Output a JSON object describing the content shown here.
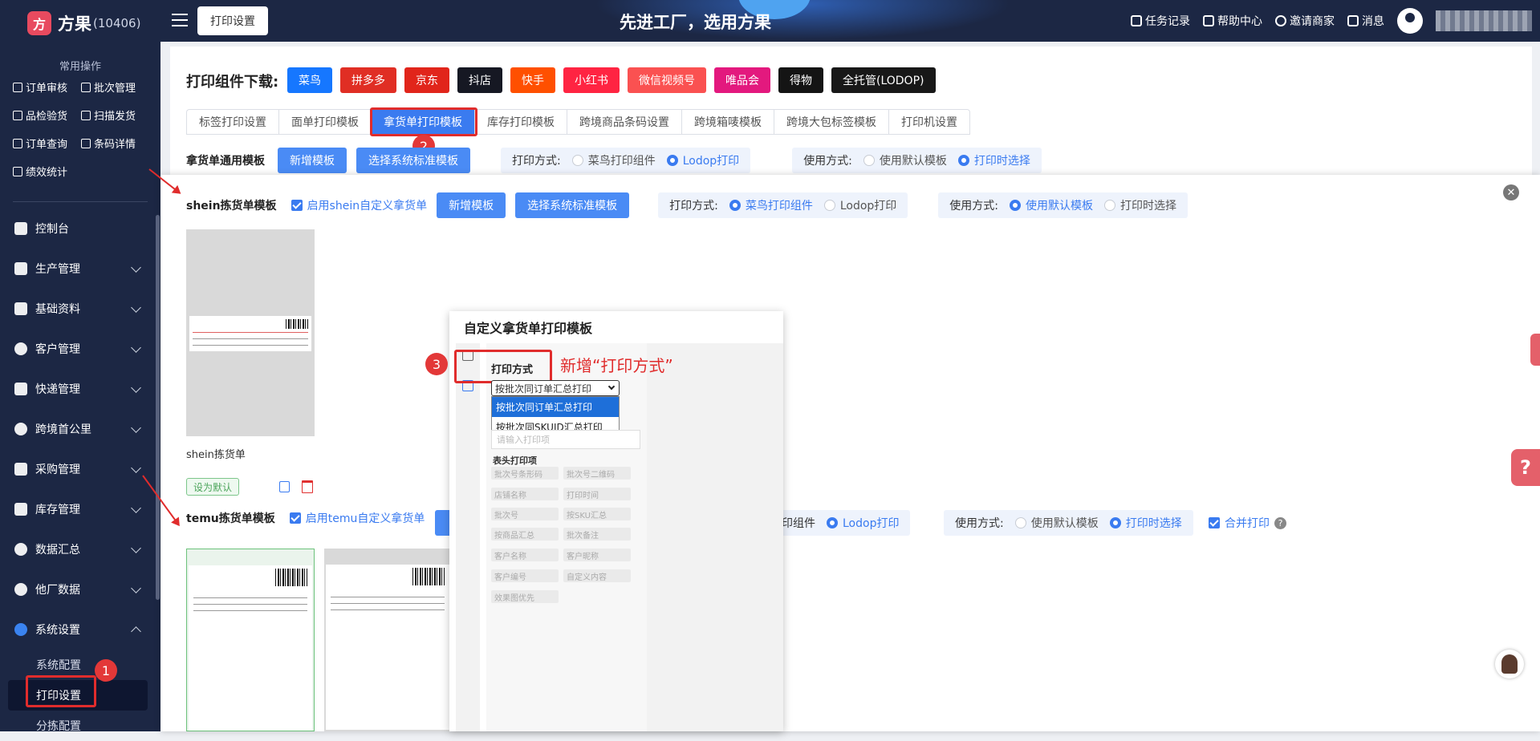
{
  "brand": {
    "name": "方果",
    "code": "(10406)",
    "logo_char": "方"
  },
  "sidebar": {
    "quick_title": "常用操作",
    "quick_items": [
      "订单审核",
      "批次管理",
      "品检验货",
      "扫描发货",
      "订单查询",
      "条码详情",
      "绩效统计"
    ],
    "menu": [
      "控制台",
      "生产管理",
      "基础资料",
      "客户管理",
      "快递管理",
      "跨境首公里",
      "采购管理",
      "库存管理",
      "数据汇总",
      "他厂数据",
      "系统设置"
    ],
    "sub": [
      "系统配置",
      "打印设置",
      "分拣配置"
    ]
  },
  "topbar": {
    "current_tab": "打印设置",
    "slogan": "先进工厂，选用方果",
    "links": [
      "任务记录",
      "帮助中心",
      "邀请商家",
      "消息"
    ]
  },
  "download": {
    "title": "打印组件下载:",
    "buttons": [
      {
        "label": "菜鸟",
        "color": "#1677ff"
      },
      {
        "label": "拼多多",
        "color": "#e02e24"
      },
      {
        "label": "京东",
        "color": "#e1251b"
      },
      {
        "label": "抖店",
        "color": "#161823"
      },
      {
        "label": "快手",
        "color": "#ff5000"
      },
      {
        "label": "小红书",
        "color": "#ff2442"
      },
      {
        "label": "微信视频号",
        "color": "#fa5151"
      },
      {
        "label": "唯品会",
        "color": "#e3197e"
      },
      {
        "label": "得物",
        "color": "#141414"
      },
      {
        "label": "全托管(LODOP)",
        "color": "#181818"
      }
    ]
  },
  "tabs": [
    "标签打印设置",
    "面单打印模板",
    "拿货单打印模板",
    "库存打印模板",
    "跨境商品条码设置",
    "跨境箱唛模板",
    "跨境大包标签模板",
    "打印机设置"
  ],
  "active_tab_index": 2,
  "general": {
    "label": "拿货单通用模板",
    "add_btn": "新增模板",
    "choose_btn": "选择系统标准模板",
    "print_mode_label": "打印方式:",
    "print_opt1": "菜鸟打印组件",
    "print_opt2": "Lodop打印",
    "use_mode_label": "使用方式:",
    "use_opt1": "使用默认模板",
    "use_opt2": "打印时选择"
  },
  "shein": {
    "title": "shein拣货单模板",
    "enable": "启用shein自定义拿货单",
    "add_btn": "新增模板",
    "choose_btn": "选择系统标准模板",
    "print_mode_label": "打印方式:",
    "print_opt1": "菜鸟打印组件",
    "print_opt2": "Lodop打印",
    "use_mode_label": "使用方式:",
    "use_opt1": "使用默认模板",
    "use_opt2": "打印时选择",
    "card_label": "shein拣货单",
    "default_tag": "设为默认"
  },
  "temu": {
    "title": "temu拣货单模板",
    "enable": "启用temu自定义拿货单",
    "print_opt1_tail": "印组件",
    "print_opt2": "Lodop打印",
    "use_mode_label": "使用方式:",
    "use_opt1": "使用默认模板",
    "use_opt2": "打印时选择",
    "merge": "合并打印",
    "help": "?"
  },
  "modal": {
    "title": "自定义拿货单打印模板",
    "print_mode_label": "打印方式",
    "select_value": "按批次同订单汇总打印",
    "options": [
      "按批次同订单汇总打印",
      "按批次同SKUID汇总打印"
    ],
    "input_placeholder": "请输入打印项",
    "header_title": "表头打印项",
    "chips": [
      "批次号条形码",
      "批次号二维码",
      "店铺名称",
      "打印时间",
      "批次号",
      "按SKU汇总",
      "按商品汇总",
      "批次备注",
      "客户名称",
      "客户昵称",
      "客户编号",
      "自定义内容",
      "效果图优先"
    ]
  },
  "annotations": {
    "n1": "1",
    "n2": "2",
    "n3": "3",
    "new_print_mode": "新增“打印方式”"
  },
  "misc": {
    "help_char": "?",
    "close_char": "✕"
  }
}
